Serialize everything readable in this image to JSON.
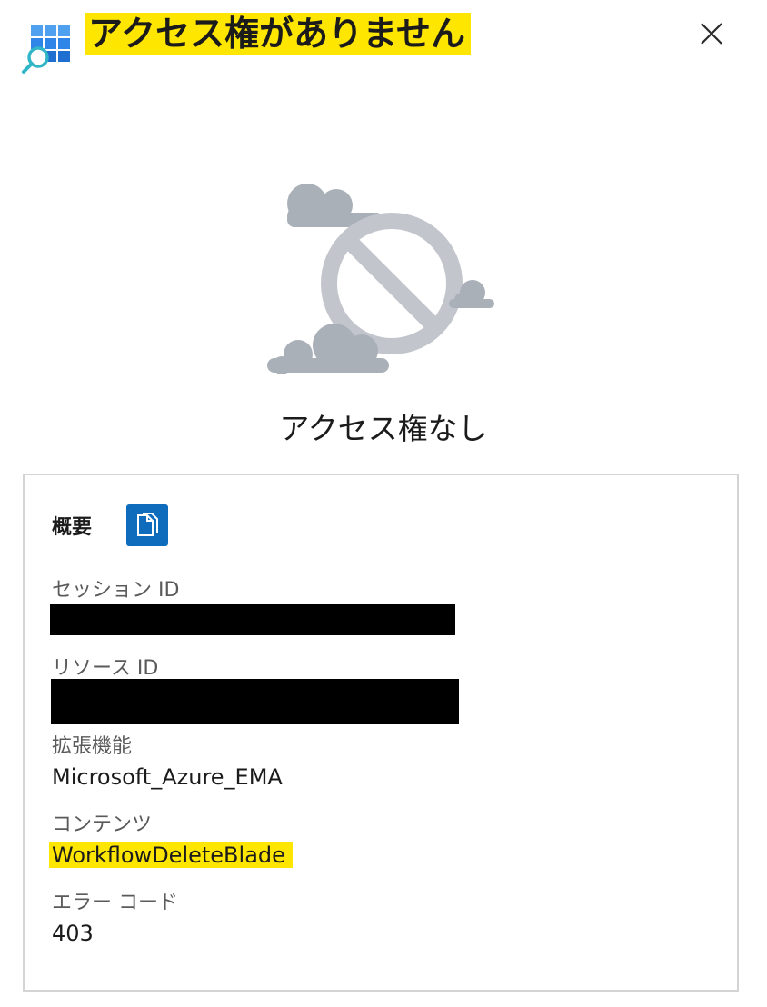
{
  "header": {
    "title": "アクセス権がありません",
    "app_icon": "resource-search-icon",
    "close_icon": "close-icon",
    "highlight_color": "#ffe600"
  },
  "main": {
    "illustration_icon": "no-access-cloud-icon",
    "subtitle": "アクセス権なし"
  },
  "summary": {
    "heading": "概要",
    "copy_icon": "copy-icon",
    "fields": [
      {
        "label": "セッション ID",
        "value": "",
        "redacted": true
      },
      {
        "label": "リソース ID",
        "value": "",
        "redacted": true
      },
      {
        "label": "拡張機能",
        "value": "Microsoft_Azure_EMA"
      },
      {
        "label": "コンテンツ",
        "value": "WorkflowDeleteBlade",
        "highlighted": true
      },
      {
        "label": "エラー コード",
        "value": "403"
      }
    ]
  },
  "colors": {
    "accent": "#0f6cbd",
    "highlight": "#ffe600",
    "illustration_gray": "#aab0b8",
    "border": "#d4d4d4"
  }
}
